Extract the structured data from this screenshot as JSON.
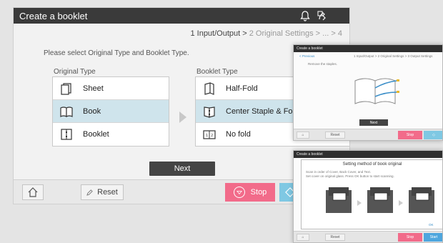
{
  "main": {
    "title": "Create a booklet",
    "steps": {
      "current": "1 Input/Output",
      "sep1": " > ",
      "next": "2 Original Settings",
      "sep2": " > ... > ",
      "last": "4"
    },
    "instruction": "Please select Original Type and Booklet Type.",
    "original_type": {
      "label": "Original Type",
      "options": [
        {
          "label": "Sheet",
          "icon": "sheet-icon",
          "selected": false
        },
        {
          "label": "Book",
          "icon": "book-icon",
          "selected": true
        },
        {
          "label": "Booklet",
          "icon": "booklet-icon",
          "selected": false
        }
      ]
    },
    "booklet_type": {
      "label": "Booklet Type",
      "options": [
        {
          "label": "Half-Fold",
          "icon": "half-fold-icon",
          "selected": false
        },
        {
          "label": "Center Staple & Fold",
          "icon": "center-staple-icon",
          "selected": true
        },
        {
          "label": "No fold",
          "icon": "no-fold-icon",
          "selected": false
        }
      ]
    },
    "next_label": "Next",
    "reset_label": "Reset",
    "stop_label": "Stop"
  },
  "mini1": {
    "title": "Create a booklet",
    "back": "< Previous",
    "steps": "1 Input/Output > 2 Original Settings > 3 Output Settings",
    "instruction": "Remove the staples.",
    "next": "Next",
    "reset": "Reset",
    "stop": "Stop"
  },
  "mini2": {
    "title": "Create a booklet",
    "dialog_title": "Setting method of book original",
    "line1": "Scan in order of Cover, Back Cover, and Text.",
    "line2": "Set cover on original glass. Press OK button to start scanning.",
    "ok": "OK",
    "reset": "Reset",
    "stop": "Stop",
    "start": "Start"
  },
  "colors": {
    "accent_selected": "#cfe4ec",
    "stop": "#f26b8a",
    "start": "#7fc8e3",
    "titlebar": "#3a3a3a"
  }
}
